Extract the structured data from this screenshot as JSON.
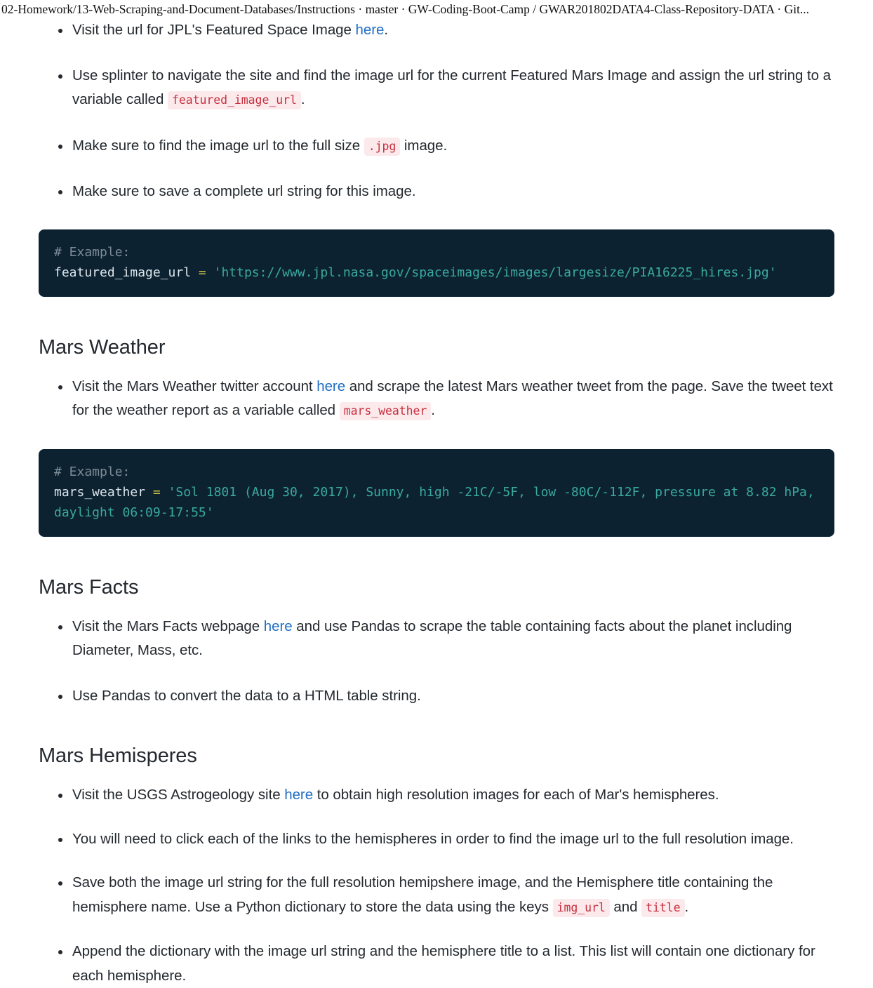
{
  "window": {
    "title": "02-Homework/13-Web-Scraping-and-Document-Databases/Instructions · master · GW-Coding-Boot-Camp / GWAR201802DATA4-Class-Repository-DATA · Git..."
  },
  "intro_bullets": [
    {
      "pre": "Visit the url for JPL's Featured Space Image ",
      "link": "here",
      "post": "."
    },
    {
      "pre": "Use splinter to navigate the site and find the image url for the current Featured Mars Image and assign the url string to a variable called ",
      "code": "featured_image_url",
      "post": "."
    },
    {
      "pre": "Make sure to find the image url to the full size ",
      "code": ".jpg",
      "post": " image."
    },
    {
      "pre": "Make sure to save a complete url string for this image.",
      "post": ""
    }
  ],
  "featured_code": {
    "comment": "# Example:",
    "var": "featured_image_url",
    "op": "=",
    "value": "'https://www.jpl.nasa.gov/spaceimages/images/largesize/PIA16225_hires.jpg'"
  },
  "weather_section": {
    "heading": "Mars Weather",
    "bullet": {
      "pre": "Visit the Mars Weather twitter account ",
      "link": "here",
      "mid": " and scrape the latest Mars weather tweet from the page. Save the tweet text for the weather report as a variable called ",
      "code": "mars_weather",
      "post": "."
    },
    "code": {
      "comment": "# Example:",
      "var": "mars_weather",
      "op": "=",
      "value": "'Sol 1801 (Aug 30, 2017), Sunny, high -21C/-5F, low -80C/-112F, pressure at 8.82 hPa, daylight 06:09-17:55'"
    }
  },
  "facts_section": {
    "heading": "Mars Facts",
    "bullets": [
      {
        "pre": "Visit the Mars Facts webpage ",
        "link": "here",
        "post": " and use Pandas to scrape the table containing facts about the planet including Diameter, Mass, etc."
      },
      {
        "pre": "Use Pandas to convert the data to a HTML table string.",
        "post": ""
      }
    ]
  },
  "hemispheres_section": {
    "heading": "Mars Hemisperes",
    "bullets": [
      {
        "pre": "Visit the USGS Astrogeology site ",
        "link": "here",
        "post": " to obtain high resolution images for each of Mar's hemispheres."
      },
      {
        "pre": "You will need to click each of the links to the hemispheres in order to find the image url to the full resolution image.",
        "post": ""
      },
      {
        "pre": "Save both the image url string for the full resolution hemipshere image, and the Hemisphere title containing the hemisphere name. Use a Python dictionary to store the data using the keys ",
        "code": "img_url",
        "mid": " and ",
        "code2": "title",
        "post": "."
      },
      {
        "pre": "Append the dictionary with the image url string and the hemisphere title to a list. This list will contain one dictionary for each hemisphere.",
        "post": ""
      }
    ]
  },
  "colors": {
    "link": "#1f6fc4",
    "inline_code_text": "#c7313f",
    "inline_code_bg": "#fbe9ec",
    "code_block_bg": "#0c2231",
    "code_string": "#3aa99f",
    "code_comment": "#7d8c96",
    "code_operator": "#d3c044",
    "body_text": "#24292e"
  }
}
